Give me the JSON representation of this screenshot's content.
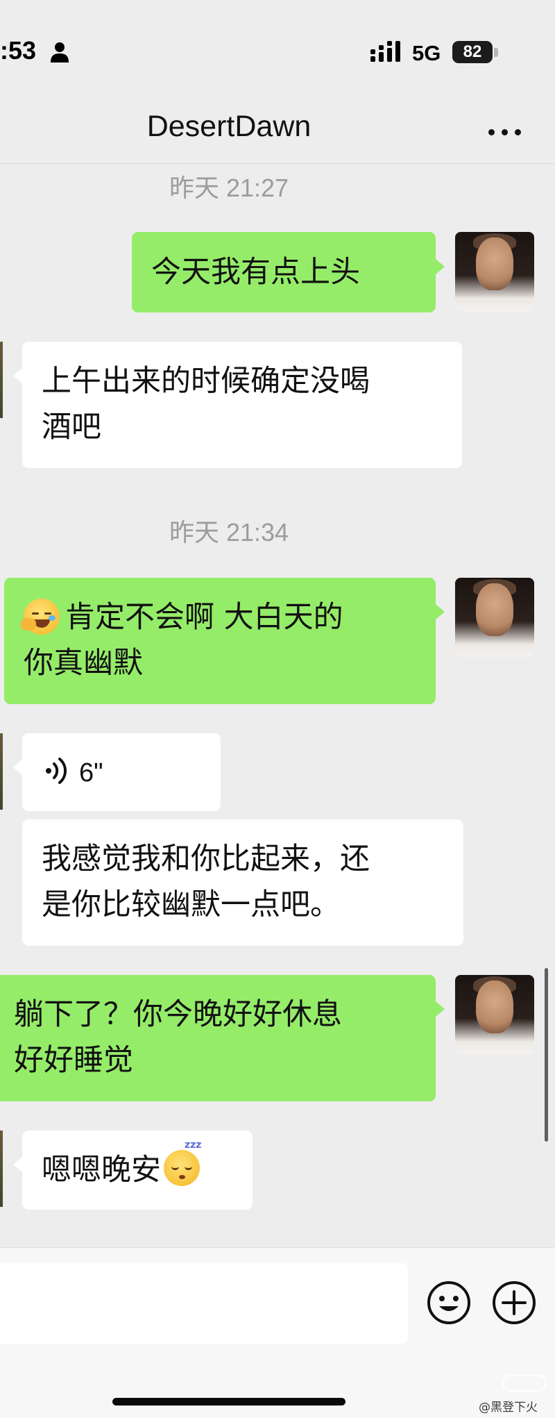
{
  "status_bar": {
    "time": ":53",
    "network": "5G",
    "battery": "82"
  },
  "header": {
    "title": "DesertDawn"
  },
  "timestamps": [
    "昨天 21:27",
    "昨天 21:34"
  ],
  "messages": [
    {
      "sender": "me",
      "lines": [
        "今天我有点上头"
      ]
    },
    {
      "sender": "other",
      "lines": [
        "上午出来的时候确定没喝",
        "酒吧"
      ]
    },
    {
      "sender": "me",
      "lines": [
        "肯定不会啊 大白天的",
        "你真幽默"
      ],
      "leading_emoji": "face-with-hand-over-mouth-tears"
    },
    {
      "sender": "other",
      "type": "voice",
      "duration": "6\""
    },
    {
      "sender": "other",
      "lines": [
        "我感觉我和你比起来，还",
        "是你比较幽默一点吧。"
      ]
    },
    {
      "sender": "me",
      "lines": [
        "躺下了？你今晚好好休息",
        "好好睡觉"
      ]
    },
    {
      "sender": "other",
      "lines": [
        "嗯嗯晚安"
      ],
      "trailing_emoji": "sleeping-face"
    }
  ],
  "input": {
    "value": "",
    "placeholder": ""
  },
  "watermark": {
    "text": "@黑登下火"
  },
  "colors": {
    "background": "#ededed",
    "my_bubble": "#95ec69",
    "their_bubble": "#ffffff",
    "timestamp_text": "#9c9c9c"
  },
  "icons": [
    "person-icon",
    "signal-icon",
    "battery-icon",
    "more-icon",
    "voice-icon",
    "emoji-icon",
    "plus-icon"
  ]
}
